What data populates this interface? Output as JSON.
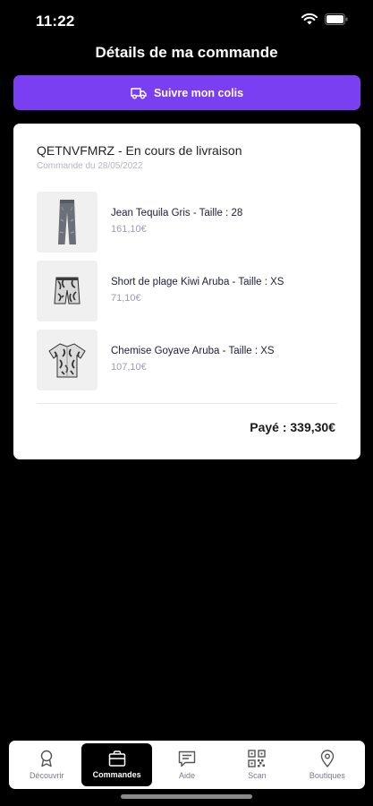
{
  "status_bar": {
    "time": "11:22"
  },
  "header": {
    "title": "Détails de ma commande"
  },
  "track_button": {
    "label": "Suivre mon colis",
    "icon": "truck-icon"
  },
  "order": {
    "title": "QETNVFMRZ - En cours de livraison",
    "date": "Commande du 28/05/2022",
    "items": [
      {
        "name": "Jean Tequila Gris - Taille : 28",
        "price": "161,10€",
        "image": "jeans-thumbnail"
      },
      {
        "name": "Short de plage Kiwi Aruba - Taille : XS",
        "price": "71,10€",
        "image": "shorts-thumbnail"
      },
      {
        "name": "Chemise Goyave Aruba - Taille : XS",
        "price": "107,10€",
        "image": "shirt-thumbnail"
      }
    ],
    "total": "Payé : 339,30€"
  },
  "tab_bar": {
    "active": "Commandes",
    "tabs": [
      {
        "label": "Découvrir",
        "icon": "award-icon"
      },
      {
        "label": "Commandes",
        "icon": "bag-icon"
      },
      {
        "label": "Aide",
        "icon": "chat-icon"
      },
      {
        "label": "Scan",
        "icon": "qr-code-icon"
      },
      {
        "label": "Boutiques",
        "icon": "map-pin-icon"
      }
    ]
  },
  "colors": {
    "accent": "#7b3ff2",
    "background": "#000000",
    "card": "#ffffff"
  }
}
